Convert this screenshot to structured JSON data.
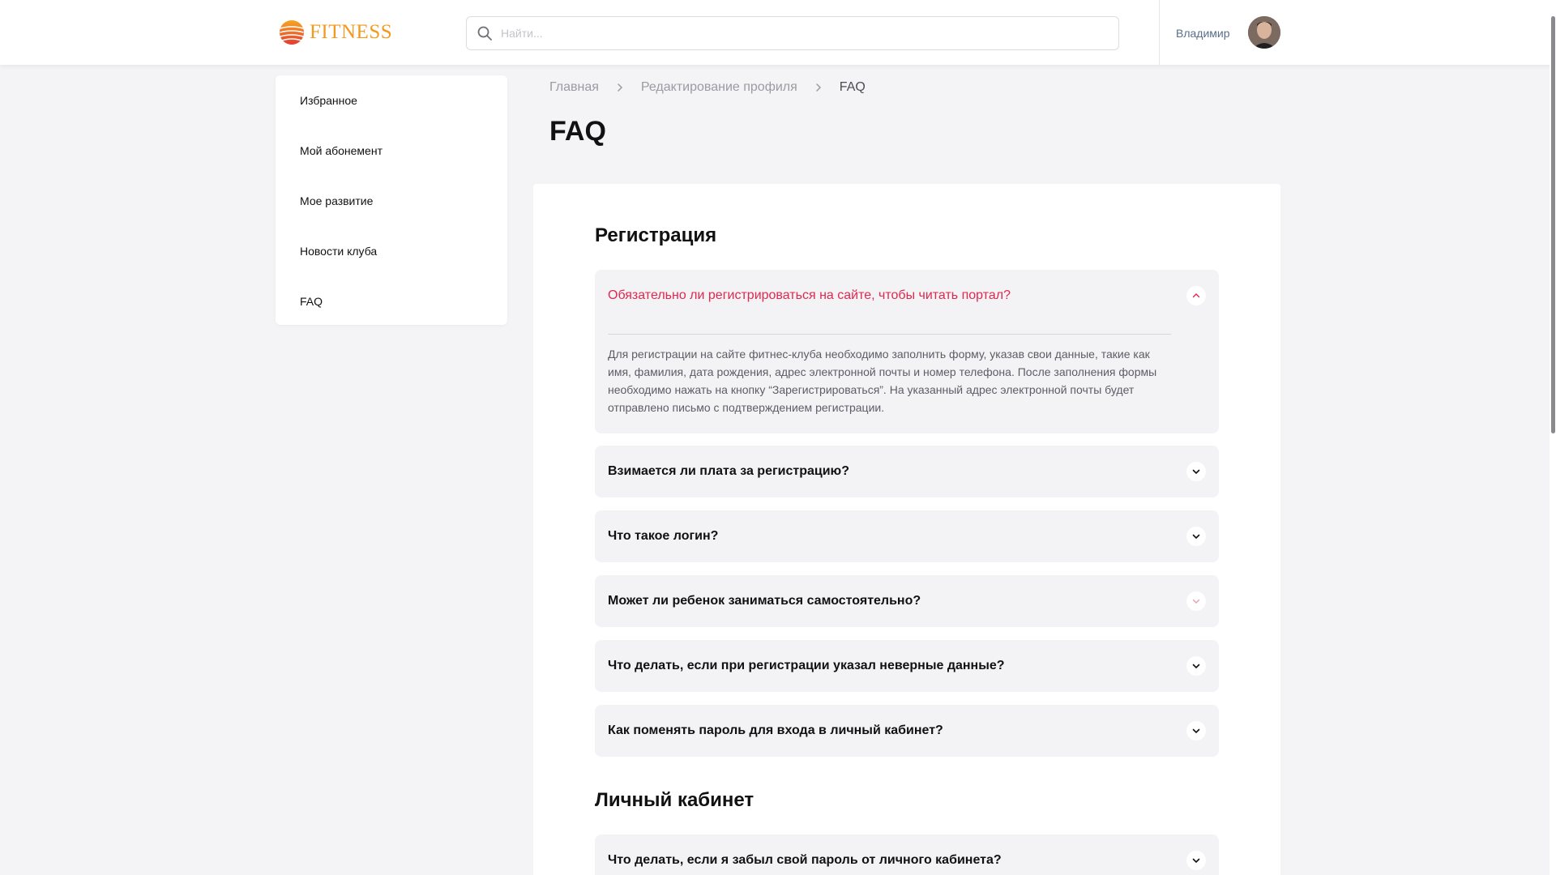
{
  "header": {
    "logo_text": "FITNESS",
    "search_placeholder": "Найти...",
    "user_name": "Владимир"
  },
  "sidebar": {
    "items": [
      {
        "label": "Избранное"
      },
      {
        "label": "Мой абонемент"
      },
      {
        "label": "Мое развитие"
      },
      {
        "label": "Новости клуба"
      },
      {
        "label": "FAQ"
      }
    ]
  },
  "breadcrumb": {
    "items": [
      "Главная",
      "Редактирование профиля",
      "FAQ"
    ]
  },
  "page_title": "FAQ",
  "sections": [
    {
      "title": "Регистрация",
      "items": [
        {
          "question": "Обязательно ли регистрироваться на сайте, чтобы читать портал?",
          "answer": "Для регистрации на сайте фитнес-клуба необходимо заполнить форму, указав свои данные, такие как имя, фамилия, дата рождения, адрес электронной почты и номер телефона. После заполнения формы необходимо нажать на кнопку “Зарегистрироваться”. На указанный адрес электронной почты будет отправлено письмо с подтверждением регистрации.",
          "expanded": true
        },
        {
          "question": "Взимается ли плата за регистрацию?",
          "expanded": false
        },
        {
          "question": "Что такое логин?",
          "expanded": false
        },
        {
          "question": "Может ли ребенок заниматься самостоятельно?",
          "expanded": false
        },
        {
          "question": "Что делать, если при регистрации указал неверные данные?",
          "expanded": false
        },
        {
          "question": "Как поменять пароль для входа в личный кабинет?",
          "expanded": false
        }
      ]
    },
    {
      "title": "Личный кабинет",
      "items": [
        {
          "question": "Что делать, если я забыл свой пароль от личного кабинета?",
          "expanded": false
        }
      ]
    }
  ],
  "colors": {
    "accent": "#e0284f",
    "logo_orange": "#f39a1e",
    "logo_red": "#e9473a",
    "page_bg": "#f4f4f6",
    "faq_bg": "#f3f3f5"
  },
  "icons": [
    "search-icon",
    "chevron-right-icon",
    "chevron-up-icon",
    "chevron-down-icon",
    "logo-icon",
    "avatar"
  ]
}
